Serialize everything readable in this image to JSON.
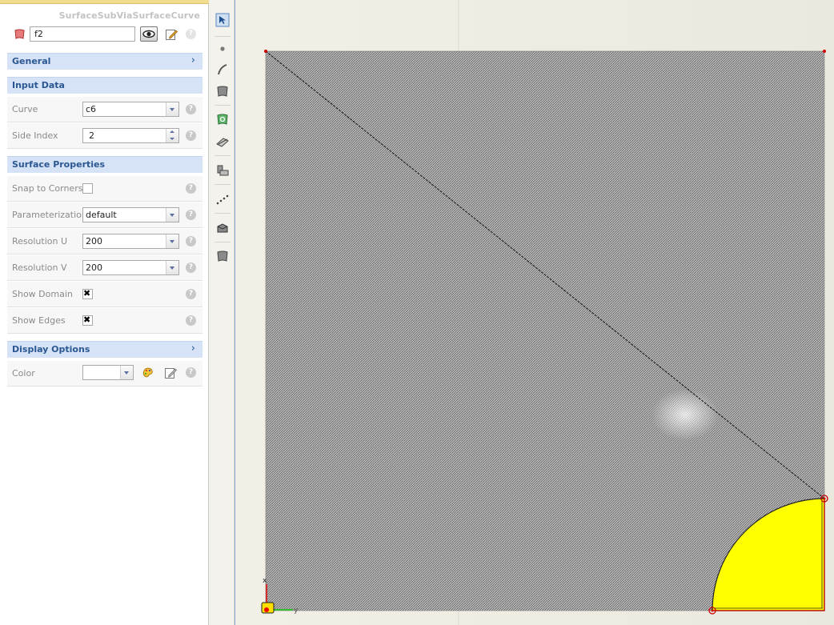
{
  "panel": {
    "object_type": "SurfaceSubViaSurfaceCurve",
    "name_value": "f2",
    "sections": {
      "general": "General",
      "input_data": "Input Data",
      "surface_properties": "Surface Properties",
      "display_options": "Display Options"
    },
    "input_data": {
      "curve_label": "Curve",
      "curve_value": "c6",
      "side_index_label": "Side Index",
      "side_index_value": "2"
    },
    "surface_properties": {
      "snap_label": "Snap to Corners",
      "snap_checked": false,
      "param_label": "Parameterization",
      "param_value": "default",
      "res_u_label": "Resolution U",
      "res_u_value": "200",
      "res_v_label": "Resolution V",
      "res_v_value": "200",
      "show_domain_label": "Show Domain",
      "show_domain_checked": true,
      "show_edges_label": "Show Edges",
      "show_edges_checked": true
    },
    "display_options": {
      "color_label": "Color",
      "color_value": ""
    },
    "help_glyph": "?"
  },
  "canvas": {
    "axis_x_label": "x",
    "axis_y_label": "y",
    "fill_color": "#ffff00",
    "surface_color": "#a0a0a0"
  },
  "icons": [
    "surface-icon",
    "eye-icon",
    "edit-icon",
    "help-icon",
    "chevron-right-icon",
    "select-arrow-icon",
    "point-icon",
    "curve-icon",
    "surface-tool-icon",
    "surface-via-curve-icon",
    "plane-icon",
    "intersect-icon",
    "dotted-line-icon",
    "solid-icon",
    "patch-icon",
    "palette-icon"
  ]
}
